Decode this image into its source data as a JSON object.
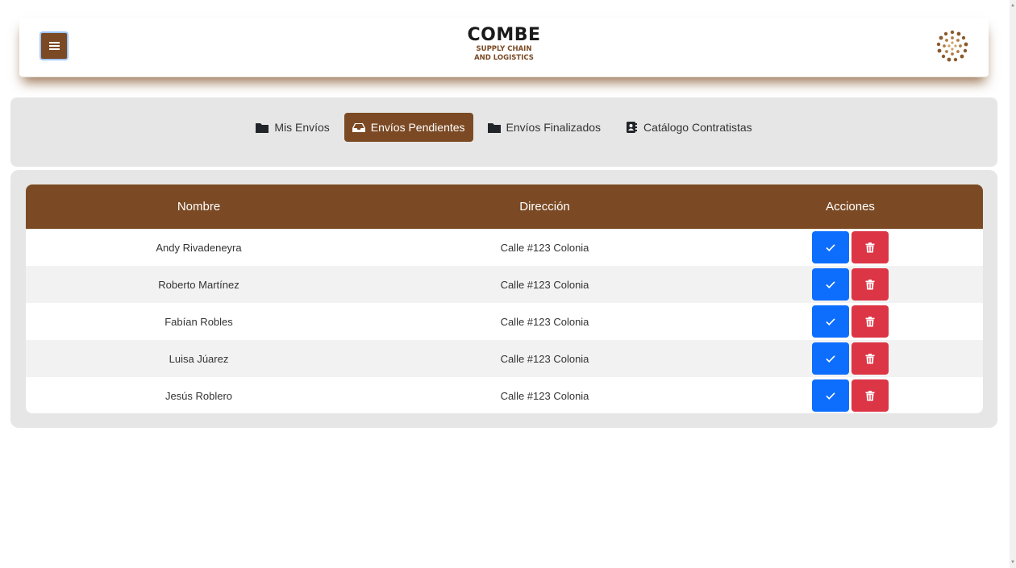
{
  "header": {
    "brand_title": "COMBE",
    "brand_sub_line1": "SUPPLY CHAIN",
    "brand_sub_line2": "AND LOGISTICS",
    "menu_icon": "hamburger-icon",
    "logo_icon": "dotted-circle-logo-icon"
  },
  "tabs": [
    {
      "label": "Mis Envíos",
      "icon": "folder-icon",
      "active": false
    },
    {
      "label": "Envíos Pendientes",
      "icon": "inbox-icon",
      "active": true
    },
    {
      "label": "Envíos Finalizados",
      "icon": "folder-icon",
      "active": false
    },
    {
      "label": "Catálogo Contratistas",
      "icon": "contact-book-icon",
      "active": false
    }
  ],
  "table": {
    "columns": [
      "Nombre",
      "Dirección",
      "Acciones"
    ],
    "rows": [
      {
        "nombre": "Andy Rivadeneyra",
        "direccion": "Calle #123 Colonia"
      },
      {
        "nombre": "Roberto Martínez",
        "direccion": "Calle #123 Colonia"
      },
      {
        "nombre": "Fabían Robles",
        "direccion": "Calle #123 Colonia"
      },
      {
        "nombre": "Luisa Júarez",
        "direccion": "Calle #123 Colonia"
      },
      {
        "nombre": "Jesús Roblero",
        "direccion": "Calle #123 Colonia"
      }
    ],
    "actions": {
      "confirm_icon": "checkmark-icon",
      "delete_icon": "trash-icon"
    }
  },
  "colors": {
    "brand_brown": "#7b4a24",
    "panel_gray": "#e6e6e6",
    "confirm_blue": "#0d6efd",
    "delete_red": "#dc3545"
  }
}
